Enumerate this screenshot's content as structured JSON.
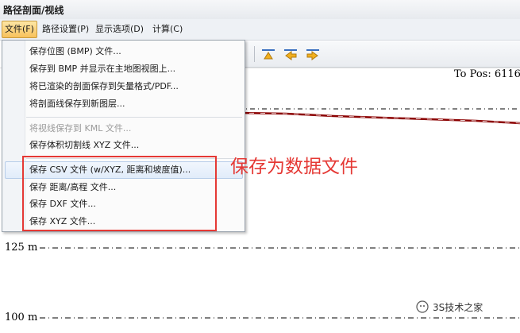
{
  "window": {
    "title": "路径剖面/视线"
  },
  "menubar": {
    "items": [
      {
        "label": "文件(F)",
        "active": true
      },
      {
        "label": "路径设置(P)"
      },
      {
        "label": "显示选项(D)"
      },
      {
        "label": "计算(C)"
      }
    ]
  },
  "file_menu": {
    "items": [
      {
        "label": "保存位图 (BMP) 文件..."
      },
      {
        "label": "保存到 BMP 并显示在主地图视图上..."
      },
      {
        "label": "将已渲染的剖面保存到矢量格式/PDF..."
      },
      {
        "label": "将剖面线保存到新图层..."
      },
      {
        "label": "将视线保存到 KML 文件...",
        "disabled": true
      },
      {
        "label": "保存体积切割线 XYZ 文件..."
      },
      {
        "label": "保存 CSV 文件 (w/XYZ, 距离和坡度值)...",
        "highlighted": true
      },
      {
        "label": "保存 距离/高程 文件..."
      },
      {
        "label": "保存 DXF 文件..."
      },
      {
        "label": "保存 XYZ 文件..."
      }
    ]
  },
  "plot": {
    "to_pos": "To Pos: 6116",
    "y_labels": [
      "125 m",
      "100 m"
    ],
    "profile_color": "#8b0000"
  },
  "annotation": {
    "text": "保存为数据文件",
    "color": "#e53935"
  },
  "watermark": {
    "text": "3S技术之家"
  }
}
